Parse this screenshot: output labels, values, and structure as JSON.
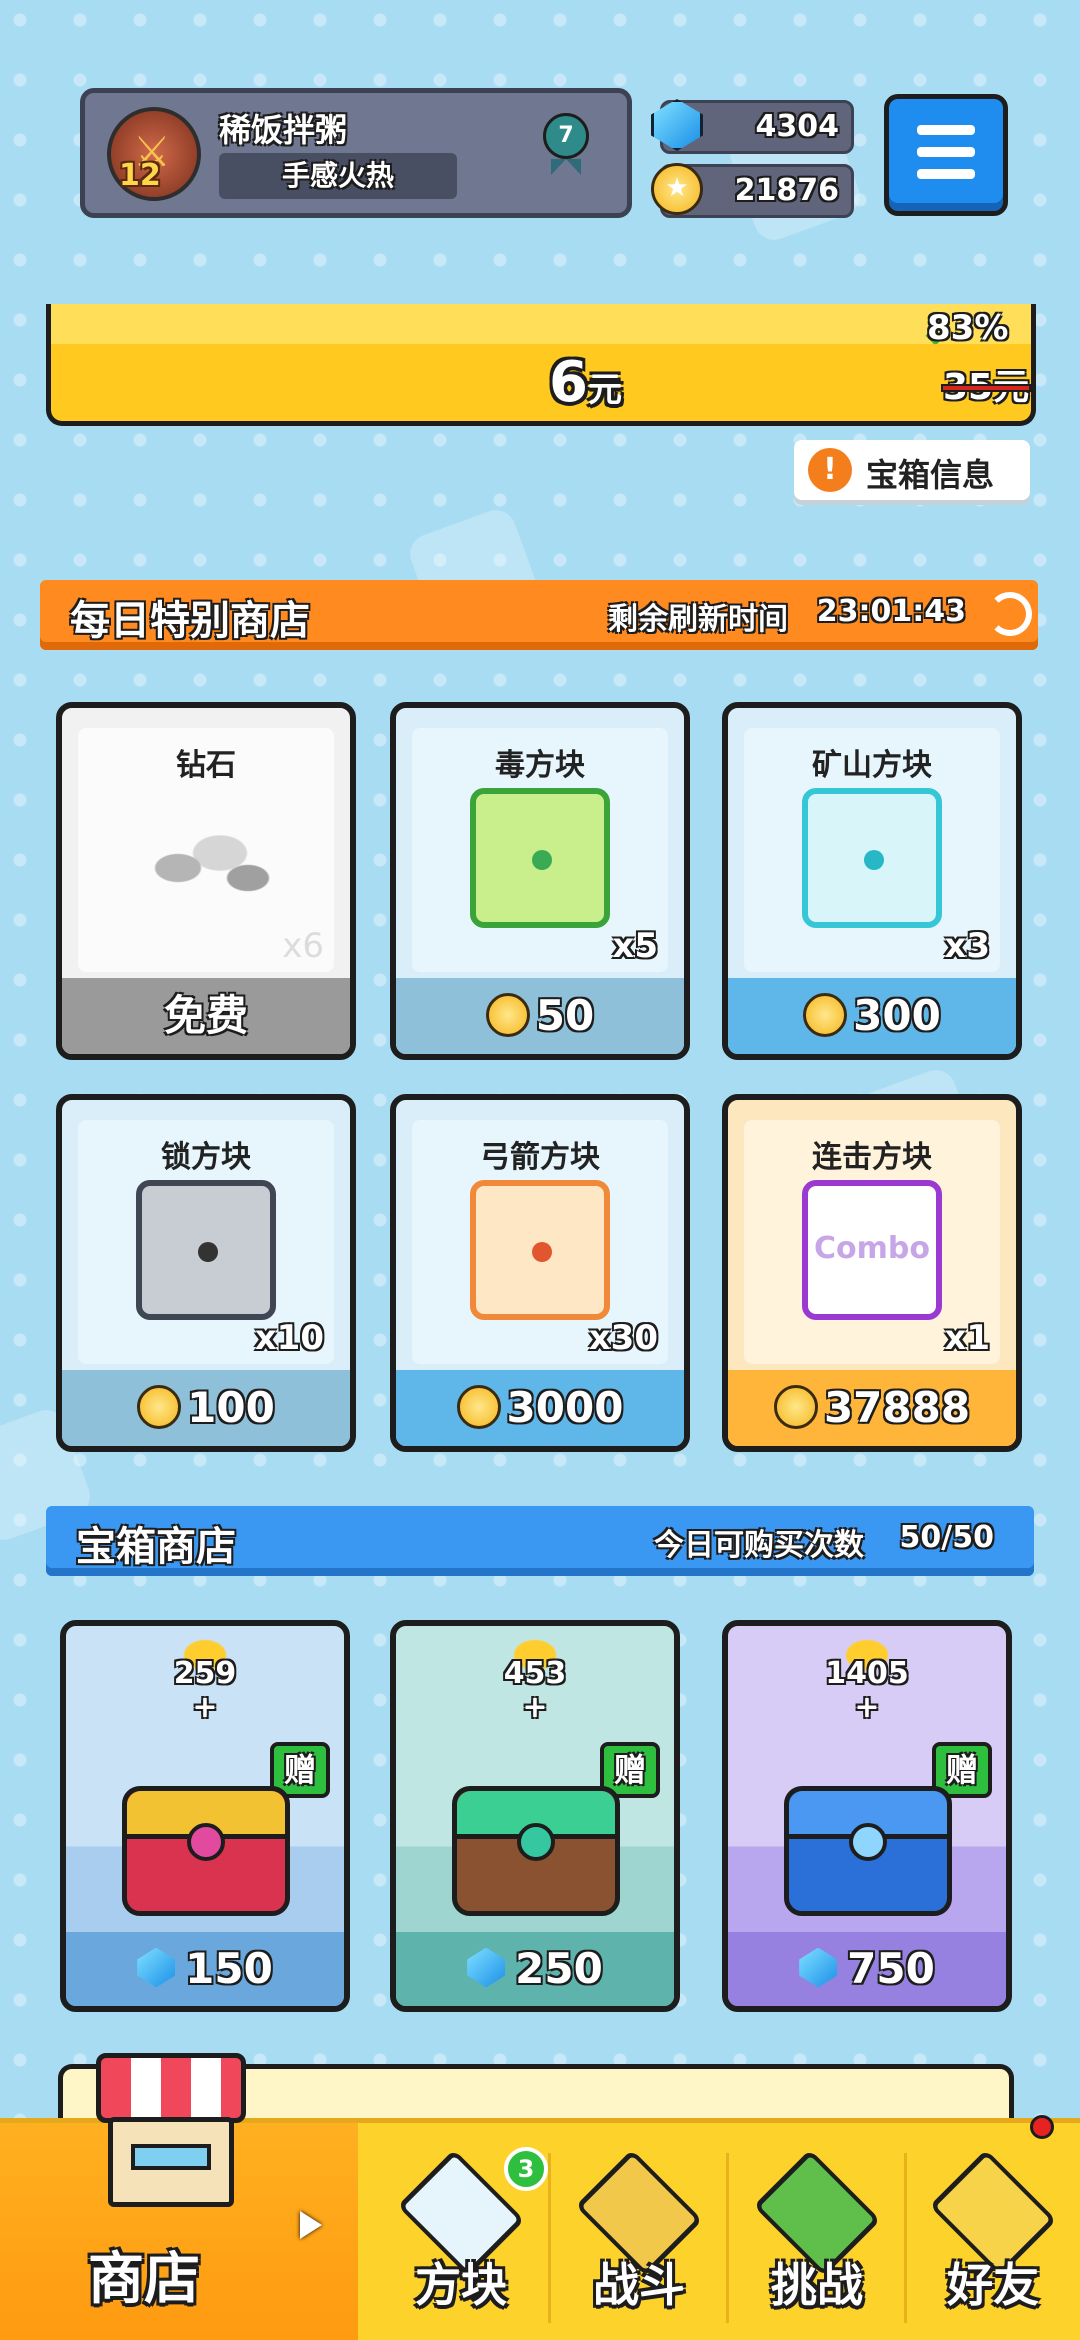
{
  "header": {
    "player_name": "稀饭拌粥",
    "player_title": "手感火热",
    "level": "12",
    "rank": "7",
    "gems": "4304",
    "coins": "21876"
  },
  "offer": {
    "price": "6",
    "price_unit": "元",
    "discount": "83%",
    "old_price": "35元",
    "chest_info_label": "宝箱信息"
  },
  "daily_shop": {
    "title": "每日特别商店",
    "refresh_label": "剩余刷新时间",
    "refresh_time": "23:01:43",
    "items": [
      {
        "name": "钻石",
        "qty": "x6",
        "price": "免费"
      },
      {
        "name": "毒方块",
        "qty": "x5",
        "price": "50"
      },
      {
        "name": "矿山方块",
        "qty": "x3",
        "price": "300"
      },
      {
        "name": "锁方块",
        "qty": "x10",
        "price": "100"
      },
      {
        "name": "弓箭方块",
        "qty": "x30",
        "price": "3000"
      },
      {
        "name": "连击方块",
        "qty": "x1",
        "price": "37888",
        "art_text": "Combo"
      }
    ]
  },
  "chest_shop": {
    "title": "宝箱商店",
    "limit_label": "今日可购买次数",
    "limit_value": "50/50",
    "gift_label": "赠",
    "plus": "+",
    "chests": [
      {
        "coins": "259",
        "price": "150"
      },
      {
        "coins": "453",
        "price": "250"
      },
      {
        "coins": "1405",
        "price": "750"
      }
    ]
  },
  "nav": {
    "items": [
      {
        "label": "商店"
      },
      {
        "label": "方块",
        "badge": "3"
      },
      {
        "label": "战斗"
      },
      {
        "label": "挑战"
      },
      {
        "label": "好友"
      }
    ]
  },
  "colors": {
    "accent_orange": "#ff8a1f",
    "accent_blue": "#3a97f2",
    "nav_yellow": "#fdd22a",
    "background": "#a8dcf2"
  }
}
